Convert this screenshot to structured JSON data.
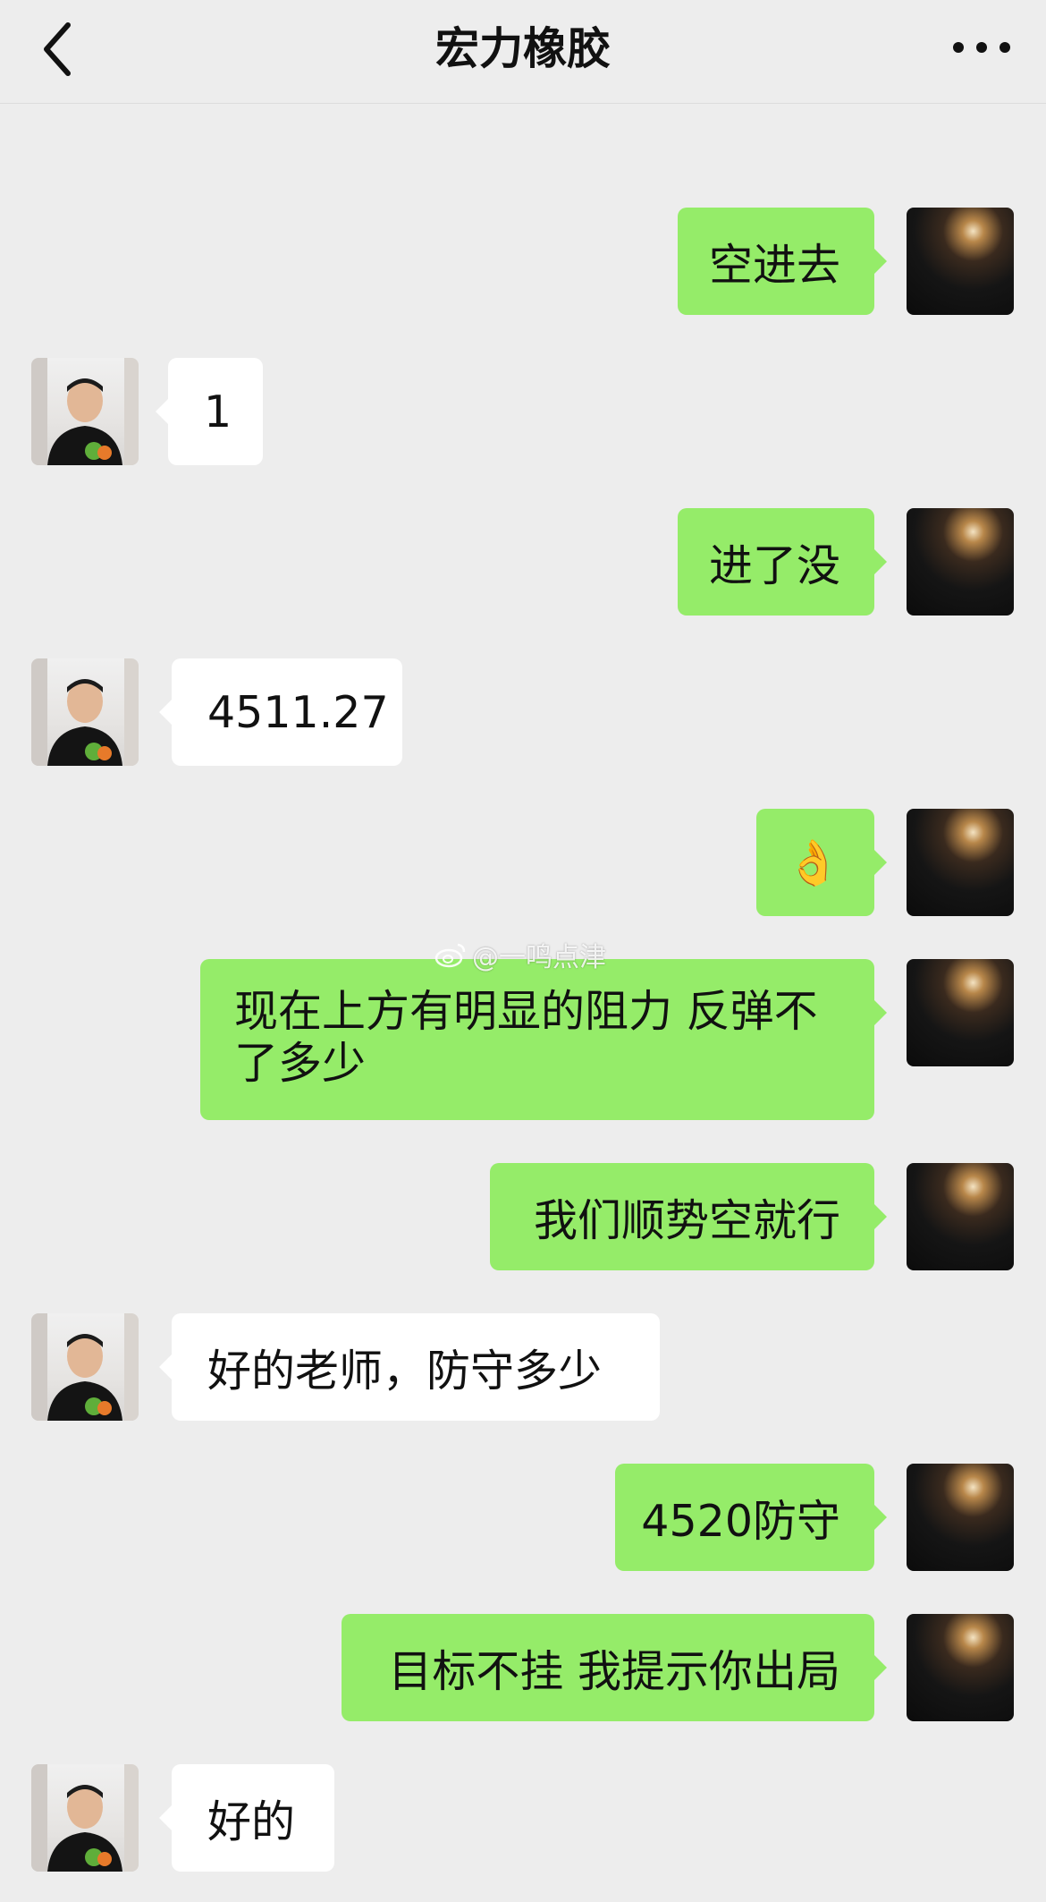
{
  "header": {
    "title": "宏力橡胶",
    "back_icon": "chevron-left-icon",
    "more_icon": "more-dots-icon"
  },
  "messages": [
    {
      "side": "out",
      "text": "空进去"
    },
    {
      "side": "in",
      "text": "1"
    },
    {
      "side": "out",
      "text": "进了没"
    },
    {
      "side": "in",
      "text": "4511.27"
    },
    {
      "side": "out",
      "text": "👌"
    },
    {
      "side": "out",
      "text": "现在上方有明显的阻力 反弹不了多少"
    },
    {
      "side": "out",
      "text": "我们顺势空就行"
    },
    {
      "side": "in",
      "text": "好的老师，防守多少"
    },
    {
      "side": "out",
      "text": "4520防守"
    },
    {
      "side": "out",
      "text": "目标不挂 我提示你出局"
    },
    {
      "side": "in",
      "text": "好的"
    }
  ],
  "watermark": {
    "icon": "weibo-icon",
    "text": "@一鸣点津"
  },
  "colors": {
    "background": "#ededed",
    "outgoing_bubble": "#95ec69",
    "incoming_bubble": "#ffffff"
  }
}
